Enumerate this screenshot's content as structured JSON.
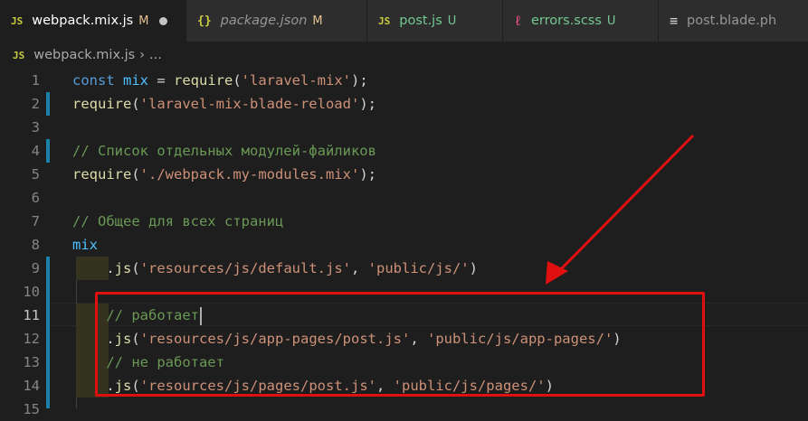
{
  "tabs": [
    {
      "icon_text": "JS",
      "icon_kind": "js",
      "name": "webpack.mix.js",
      "status": "M",
      "dirty": true,
      "active": true,
      "italic": false
    },
    {
      "icon_text": "{}",
      "icon_kind": "json",
      "name": "package.json",
      "status": "M",
      "dirty": false,
      "active": false,
      "italic": true
    },
    {
      "icon_text": "JS",
      "icon_kind": "js",
      "name": "post.js",
      "status": "U",
      "dirty": false,
      "active": false,
      "italic": false
    },
    {
      "icon_text": "ℓ",
      "icon_kind": "scss",
      "name": "errors.scss",
      "status": "U",
      "dirty": false,
      "active": false,
      "italic": false
    },
    {
      "icon_text": "≡",
      "icon_kind": "blade",
      "name": "post.blade.ph",
      "status": "",
      "dirty": false,
      "active": false,
      "italic": false
    }
  ],
  "breadcrumb": {
    "icon_text": "JS",
    "file": "webpack.mix.js",
    "separator": "›",
    "rest": "..."
  },
  "code_lines": [
    {
      "n": "1",
      "tokens": [
        [
          "kw",
          "const "
        ],
        [
          "var",
          "mix"
        ],
        [
          "plain",
          " = "
        ],
        [
          "fn",
          "require"
        ],
        [
          "plain",
          "("
        ],
        [
          "str",
          "'laravel-mix'"
        ],
        [
          "plain",
          ");"
        ]
      ]
    },
    {
      "n": "2",
      "tokens": [
        [
          "fn",
          "require"
        ],
        [
          "plain",
          "("
        ],
        [
          "str",
          "'laravel-mix-blade-reload'"
        ],
        [
          "plain",
          ");"
        ]
      ]
    },
    {
      "n": "3",
      "tokens": []
    },
    {
      "n": "4",
      "tokens": [
        [
          "cm",
          "// Список отдельных модулей-файликов"
        ]
      ]
    },
    {
      "n": "5",
      "tokens": [
        [
          "fn",
          "require"
        ],
        [
          "plain",
          "("
        ],
        [
          "str",
          "'./webpack.my-modules.mix'"
        ],
        [
          "plain",
          ");"
        ]
      ]
    },
    {
      "n": "6",
      "tokens": []
    },
    {
      "n": "7",
      "tokens": [
        [
          "cm",
          "// Общее для всех страниц"
        ]
      ]
    },
    {
      "n": "8",
      "tokens": [
        [
          "var",
          "mix"
        ]
      ]
    },
    {
      "n": "9",
      "tokens": [
        [
          "plain",
          "    ."
        ],
        [
          "fn",
          "js"
        ],
        [
          "plain",
          "("
        ],
        [
          "str",
          "'resources/js/default.js'"
        ],
        [
          "plain",
          ", "
        ],
        [
          "str",
          "'public/js/'"
        ],
        [
          "plain",
          ")"
        ]
      ]
    },
    {
      "n": "10",
      "tokens": []
    },
    {
      "n": "11",
      "tokens": [
        [
          "plain",
          "    "
        ],
        [
          "cm",
          "// работает"
        ]
      ]
    },
    {
      "n": "12",
      "tokens": [
        [
          "plain",
          "    ."
        ],
        [
          "fn",
          "js"
        ],
        [
          "plain",
          "("
        ],
        [
          "str",
          "'resources/js/app-pages/post.js'"
        ],
        [
          "plain",
          ", "
        ],
        [
          "str",
          "'public/js/app-pages/'"
        ],
        [
          "plain",
          ")"
        ]
      ]
    },
    {
      "n": "13",
      "tokens": [
        [
          "plain",
          "    "
        ],
        [
          "cm",
          "// не работает"
        ]
      ]
    },
    {
      "n": "14",
      "tokens": [
        [
          "plain",
          "    ."
        ],
        [
          "fn",
          "js"
        ],
        [
          "plain",
          "("
        ],
        [
          "str",
          "'resources/js/pages/post.js'"
        ],
        [
          "plain",
          ", "
        ],
        [
          "str",
          "'public/js/pages/'"
        ],
        [
          "plain",
          ")"
        ]
      ]
    },
    {
      "n": "15",
      "tokens": []
    }
  ],
  "current_line": "11",
  "colors": {
    "annotation": "#e01010",
    "modified": "#e2c08d",
    "untracked": "#73c991",
    "gutter_change": "#1b81a8"
  }
}
